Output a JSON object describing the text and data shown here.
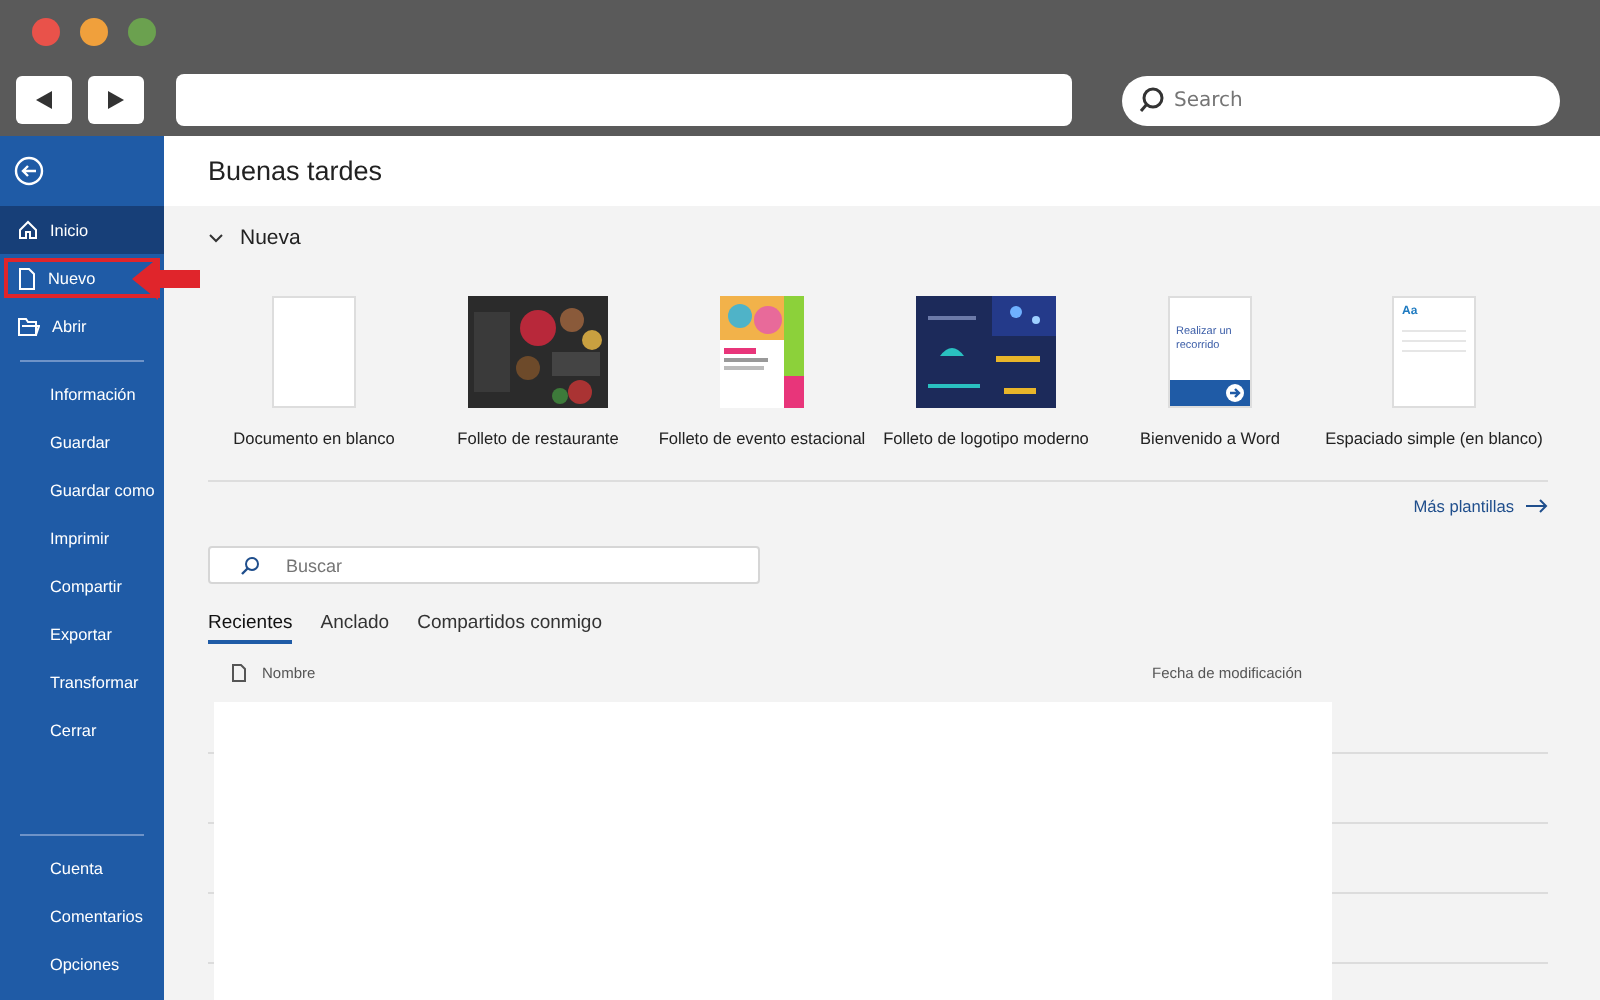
{
  "browser": {
    "search_placeholder": "Search"
  },
  "sidebar": {
    "top_items": [
      {
        "label": "Inicio",
        "selected": true,
        "highlighted": false
      },
      {
        "label": "Nuevo",
        "selected": false,
        "highlighted": true
      },
      {
        "label": "Abrir",
        "selected": false,
        "highlighted": false
      }
    ],
    "middle_items": [
      "Información",
      "Guardar",
      "Guardar como",
      "Imprimir",
      "Compartir",
      "Exportar",
      "Transformar",
      "Cerrar"
    ],
    "bottom_items": [
      "Cuenta",
      "Comentarios",
      "Opciones"
    ]
  },
  "greeting": "Buenas tardes",
  "new_section": {
    "title": "Nueva",
    "expanded": true
  },
  "templates": [
    {
      "kind": "blank",
      "label": "Documento en blanco"
    },
    {
      "kind": "restaurant",
      "label": "Folleto de restaurante"
    },
    {
      "kind": "event",
      "label": "Folleto de evento estacional"
    },
    {
      "kind": "logo",
      "label": "Folleto de logotipo moderno"
    },
    {
      "kind": "welcome",
      "label": "Bienvenido a Word",
      "thumbnail_text": "Realizar un recorrido"
    },
    {
      "kind": "spacing",
      "label": "Espaciado simple (en blanco)",
      "thumbnail_text": "Aa"
    }
  ],
  "more_templates": "Más plantillas",
  "search": {
    "placeholder": "Buscar"
  },
  "tabs": [
    {
      "label": "Recientes",
      "selected": true
    },
    {
      "label": "Anclado",
      "selected": false
    },
    {
      "label": "Compartidos conmigo",
      "selected": false
    }
  ],
  "file_table": {
    "columns": [
      "Nombre",
      "Fecha de modificación"
    ]
  }
}
